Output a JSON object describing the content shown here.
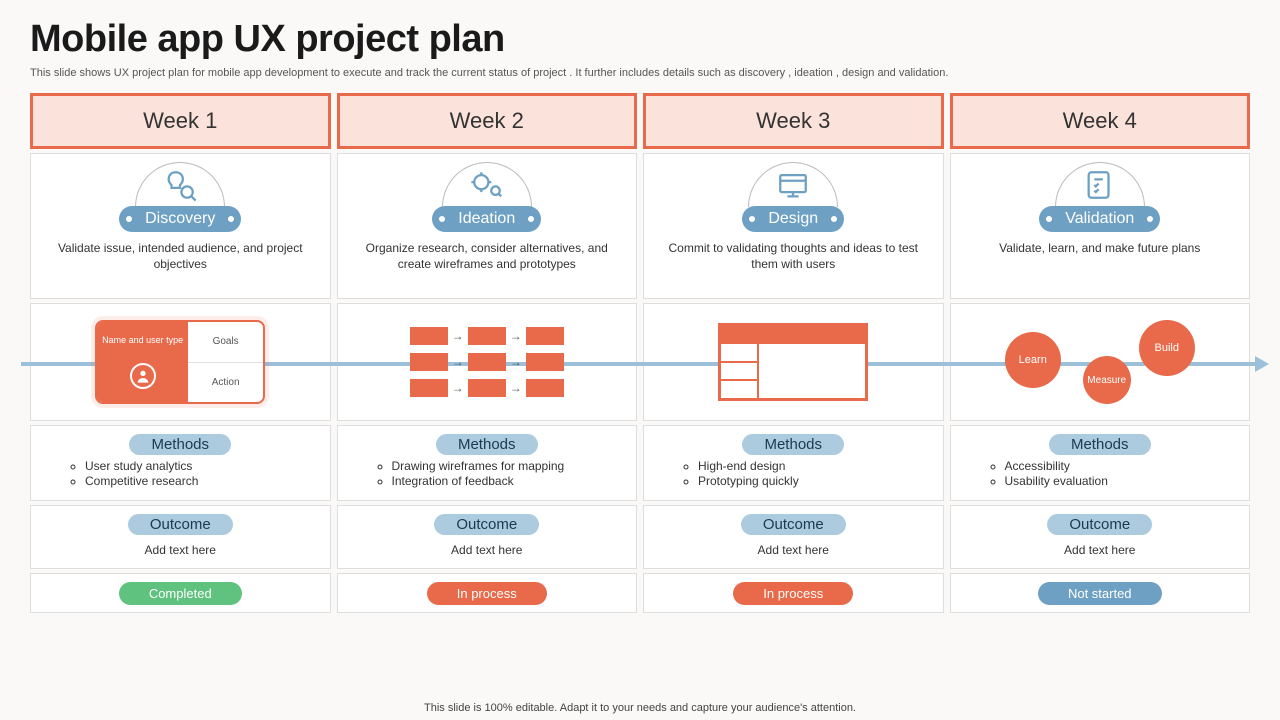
{
  "title": "Mobile app UX project plan",
  "subtitle": "This slide shows UX project plan for mobile app development to execute and track the current status of project . It further includes details such as discovery , ideation , design and validation.",
  "footer": "This slide is 100% editable. Adapt it to your needs and capture your audience's attention.",
  "methods_label": "Methods",
  "outcome_label": "Outcome",
  "outcome_placeholder": "Add text here",
  "persona": {
    "name": "Name and user type",
    "goals": "Goals",
    "action": "Action"
  },
  "circles": {
    "learn": "Learn",
    "build": "Build",
    "measure": "Measure"
  },
  "weeks": [
    {
      "header": "Week 1",
      "phase": "Discovery",
      "desc": "Validate issue, intended audience, and project objectives",
      "methods": [
        "User study analytics",
        "Competitive research"
      ],
      "status": "Completed",
      "status_class": "s-green"
    },
    {
      "header": "Week 2",
      "phase": "Ideation",
      "desc": "Organize research, consider alternatives, and create wireframes and prototypes",
      "methods": [
        "Drawing wireframes for mapping",
        "Integration of feedback"
      ],
      "status": "In process",
      "status_class": "s-orange"
    },
    {
      "header": "Week 3",
      "phase": "Design",
      "desc": "Commit to validating thoughts and ideas to test them with users",
      "methods": [
        "High-end design",
        "Prototyping quickly"
      ],
      "status": "In process",
      "status_class": "s-orange"
    },
    {
      "header": "Week 4",
      "phase": "Validation",
      "desc": "Validate, learn, and make future plans",
      "methods": [
        "Accessibility",
        "Usability evaluation"
      ],
      "status": "Not started",
      "status_class": "s-blue"
    }
  ]
}
